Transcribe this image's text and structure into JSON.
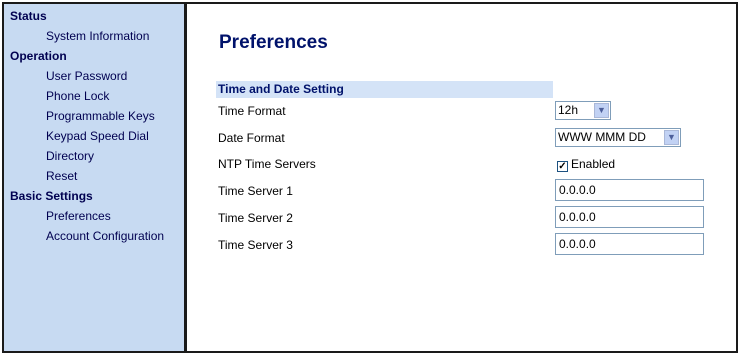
{
  "sidebar": {
    "sections": [
      {
        "heading": "Status",
        "items": [
          "System Information"
        ]
      },
      {
        "heading": "Operation",
        "items": [
          "User Password",
          "Phone Lock",
          "Programmable Keys",
          "Keypad Speed Dial",
          "Directory",
          "Reset"
        ]
      },
      {
        "heading": "Basic Settings",
        "items": [
          "Preferences",
          "Account Configuration"
        ]
      }
    ]
  },
  "main": {
    "title": "Preferences",
    "section_title": "Time and Date Setting",
    "fields": {
      "time_format": {
        "label": "Time Format",
        "value": "12h"
      },
      "date_format": {
        "label": "Date Format",
        "value": "WWW MMM DD"
      },
      "ntp": {
        "label": "NTP Time Servers",
        "checkbox_label": "Enabled",
        "checked": true
      },
      "time_server_1": {
        "label": "Time Server 1",
        "value": "0.0.0.0"
      },
      "time_server_2": {
        "label": "Time Server 2",
        "value": "0.0.0.0"
      },
      "time_server_3": {
        "label": "Time Server 3",
        "value": "0.0.0.0"
      }
    }
  },
  "icons": {
    "dropdown": "chevron-down-icon",
    "check": "checkmark-icon"
  },
  "colors": {
    "sidebar_bg": "#c7daf2",
    "section_bg": "#d4e3f7",
    "title": "#00126b"
  }
}
